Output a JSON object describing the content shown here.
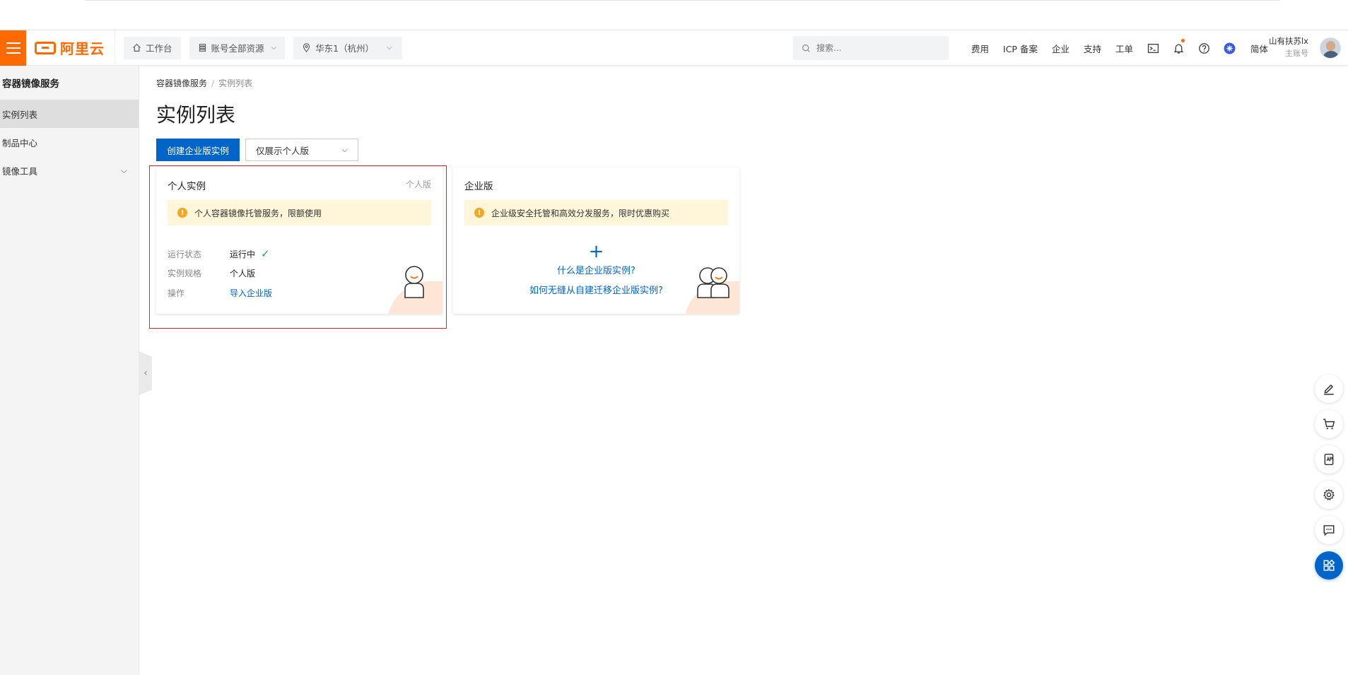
{
  "brand": {
    "logo_text": "阿里云",
    "accent": "#ff6a00",
    "primary": "#0064c8"
  },
  "navbar": {
    "workbench_label": "工作台",
    "resource_label": "账号全部资源",
    "region_label": "华东1（杭州）",
    "search_placeholder": "搜索...",
    "links": {
      "billing": "费用",
      "icp": "ICP 备案",
      "enterprise": "企业",
      "support": "支持",
      "ticket": "工单"
    },
    "lang": "简体",
    "user_name": "山有扶苏lx",
    "user_role": "主账号"
  },
  "sidebar": {
    "title": "容器镜像服务",
    "items": [
      {
        "label": "实例列表",
        "active": true
      },
      {
        "label": "制品中心",
        "active": false
      },
      {
        "label": "镜像工具",
        "active": false,
        "expandable": true
      }
    ]
  },
  "breadcrumb": {
    "root": "容器镜像服务",
    "sep": "/",
    "current": "实例列表"
  },
  "page": {
    "title": "实例列表",
    "create_button": "创建企业版实例",
    "filter_select": "仅展示个人版"
  },
  "personal_card": {
    "title": "个人实例",
    "tag": "个人版",
    "notice": "个人容器镜像托管服务，限额使用",
    "rows": {
      "status_key": "运行状态",
      "status_value": "运行中",
      "spec_key": "实例规格",
      "spec_value": "个人版",
      "op_key": "操作",
      "op_link": "导入企业版"
    }
  },
  "enterprise_card": {
    "title": "企业版",
    "notice": "企业级安全托管和高效分发服务，限时优惠购买",
    "plus": "+",
    "link1": "什么是企业版实例?",
    "link2": "如何无缝从自建迁移企业版实例?"
  },
  "icons": {
    "menu": "hamburger-icon",
    "home": "home-icon",
    "resource": "stack-icon",
    "location": "location-pin-icon",
    "search": "search-icon",
    "terminal": "terminal-icon",
    "bell": "bell-icon",
    "help": "question-icon",
    "ai": "assistant-icon",
    "edit": "edit-icon",
    "cart": "cart-icon",
    "app": "app-icon",
    "settings": "gear-icon",
    "chat": "chat-icon",
    "grid": "grid-icon"
  }
}
